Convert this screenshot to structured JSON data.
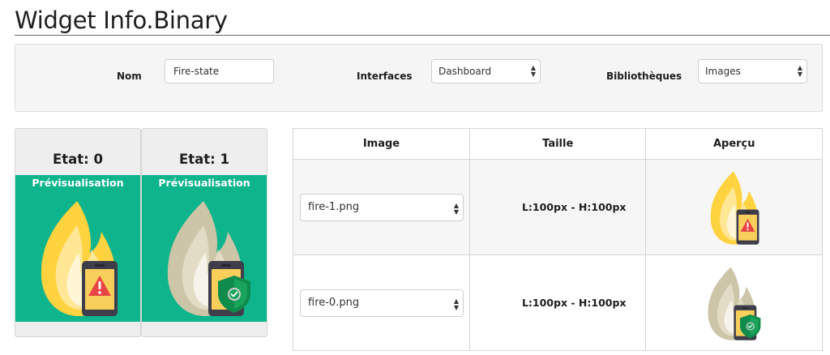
{
  "page": {
    "title": "Widget Info.Binary"
  },
  "form": {
    "name_label": "Nom",
    "name_value": "Fire-state",
    "interfaces_label": "Interfaces",
    "interfaces_value": "Dashboard",
    "libraries_label": "Bibliothèques",
    "libraries_value": "Images"
  },
  "states": [
    {
      "title": "Etat: 0",
      "preview_label": "Prévisualisation",
      "icon": "fire-warning-icon"
    },
    {
      "title": "Etat: 1",
      "preview_label": "Prévisualisation",
      "icon": "fire-safe-icon"
    }
  ],
  "table": {
    "headers": [
      "Image",
      "Taille",
      "Aperçu"
    ],
    "rows": [
      {
        "image": "fire-1.png",
        "size": "L:100px - H:100px",
        "icon": "fire-warning-icon"
      },
      {
        "image": "fire-0.png",
        "size": "L:100px - H:100px",
        "icon": "fire-safe-icon"
      }
    ]
  },
  "colors": {
    "preview_bg": "#0eb48b",
    "fire_active": "#ffd23f",
    "fire_inactive": "#cdc5a8",
    "alert_red": "#e84545",
    "shield_green": "#19a35b"
  }
}
